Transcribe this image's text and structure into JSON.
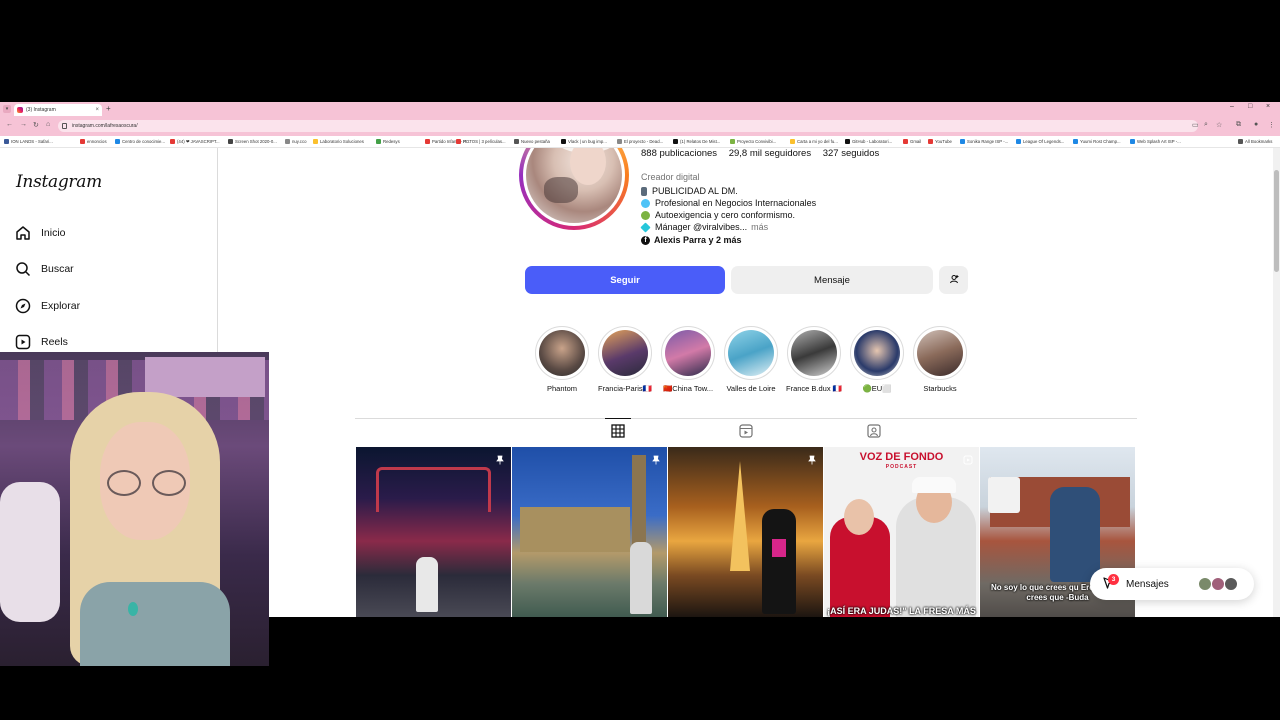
{
  "browser": {
    "tab_title": "(3) Instagram",
    "url": "instagram.com/lafresaoscura/",
    "bookmarks": [
      "ION LANDS - Safari...",
      "ennoncios",
      "Centro de conocimie...",
      "(44) ❤ JAVASCRIPT...",
      "Screen Shot 2020-0...",
      "nuy.cco",
      "Laboratorio Soluciones",
      "Redesys",
      "Partido Infantil - R...",
      "POTOS | 3 películas...",
      "Nuevo pestaña",
      "Vlack | un bug imp...",
      "El proyecto - Dead...",
      "(1) Relatos De Mist...",
      "Proyecto Convivibi...",
      "Carta a mi yo del fu...",
      "GitHub - Laboratori...",
      "Gmail",
      "YouTube",
      "Sonika Range ISP -...",
      "League Of Legends...",
      "Yuumi Rost Champ...",
      "Web Splash Art ISP -...",
      "All Bookmarks"
    ]
  },
  "sidebar": {
    "logo": "Instagram",
    "items": [
      {
        "label": "Inicio",
        "icon": "home-icon"
      },
      {
        "label": "Buscar",
        "icon": "search-icon"
      },
      {
        "label": "Explorar",
        "icon": "compass-icon"
      },
      {
        "label": "Reels",
        "icon": "reels-icon"
      }
    ]
  },
  "profile": {
    "posts": "888 publicaciones",
    "followers": "29,8 mil seguidores",
    "following": "327 seguidos",
    "category": "Creador digital",
    "bio": [
      "PUBLICIDAD AL DM.",
      "Profesional en Negocios Internacionales",
      "Autoexigencia y cero conformismo.",
      "Mánager @viralvibes..."
    ],
    "more": "más",
    "followed_by": "Alexis Parra y 2 más",
    "follow_label": "Seguir",
    "message_label": "Mensaje"
  },
  "highlights": [
    "Phantom",
    "Francia-Paris🇫🇷",
    "🇨🇳China Tow...",
    "Valles de Loire",
    "France B.dux 🇫🇷",
    "🟢EU⬜",
    "Starbucks"
  ],
  "posts": [
    {
      "caption": ""
    },
    {
      "caption": ""
    },
    {
      "caption": ""
    },
    {
      "caption": "¡ASÍ ERA JUDAS!\" LA FRESA MÁS",
      "header": "VOZ DE FONDO",
      "subheader": "PODCAST"
    },
    {
      "caption": "No soy lo que crees qu Eres lo que crees que -Buda"
    }
  ],
  "messages": {
    "label": "Mensajes",
    "badge": "3"
  },
  "colors": {
    "follow": "#4a5df9",
    "tabstrip": "#f6c3d6",
    "badge": "#ff3040"
  }
}
